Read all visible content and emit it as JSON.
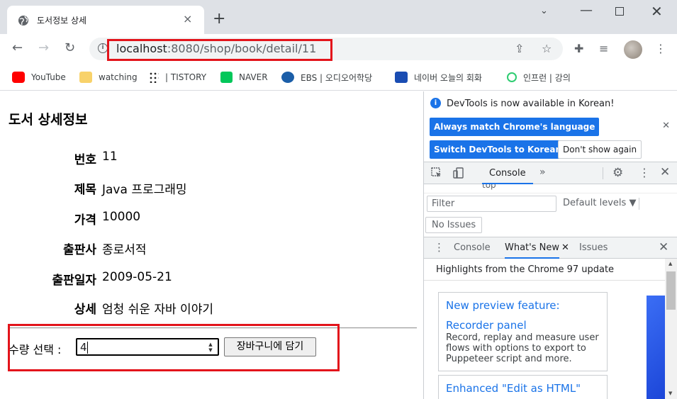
{
  "browser": {
    "tab_title": "도서정보 상세",
    "url_host": "localhost",
    "url_rest": ":8080/shop/book/detail/11"
  },
  "bookmarks": [
    {
      "label": "YouTube",
      "icon": "youtube-icon",
      "color": "#ff0000"
    },
    {
      "label": "watching",
      "icon": "folder-icon",
      "color": "#f8d26a"
    },
    {
      "label": "| TISTORY",
      "icon": "tistory-icon",
      "color": "#222222"
    },
    {
      "label": "NAVER",
      "icon": "naver-icon",
      "color": "#03c75a"
    },
    {
      "label": "EBS | 오디오어학당",
      "icon": "ebs-icon",
      "color": "#1b5ea8"
    },
    {
      "label": "네이버 오늘의 회화",
      "icon": "ga-icon",
      "color": "#1a4db3"
    },
    {
      "label": "인프런 | 강의",
      "icon": "inflearn-icon",
      "color": "#2ecc71"
    }
  ],
  "page": {
    "heading": "도서 상세정보",
    "fields": [
      {
        "label": "번호",
        "value": "11"
      },
      {
        "label": "제목",
        "value": "Java 프로그래밍"
      },
      {
        "label": "가격",
        "value": "10000"
      },
      {
        "label": "출판사",
        "value": "종로서적"
      },
      {
        "label": "출판일자",
        "value": "2009-05-21"
      },
      {
        "label": "상세",
        "value": "엄청 쉬운 자바 이야기"
      }
    ],
    "qty_label": "수량 선택 :",
    "qty_value": "4",
    "cart_button": "장바구니에 담기"
  },
  "devtools": {
    "banner_message": "DevTools is now available in Korean!",
    "btn_match": "Always match Chrome's language",
    "btn_switch": "Switch DevTools to Korean",
    "btn_dont": "Don't show again",
    "main_tab": "Console",
    "partial_top": "top",
    "filter_placeholder": "Filter",
    "levels": "Default levels",
    "issues": "No Issues",
    "drawer_tabs": [
      "Console",
      "What's New",
      "Issues"
    ],
    "highlights": "Highlights from the Chrome 97 update",
    "cards": [
      {
        "title": "New preview feature: Recorder panel",
        "desc": "Record, replay and measure user flows with options to export to Puppeteer script and more."
      },
      {
        "title": "Enhanced \"Edit as HTML\" with",
        "desc": ""
      }
    ]
  },
  "colors": {
    "accent": "#1a73e8",
    "highlight_box": "#e3141b"
  }
}
